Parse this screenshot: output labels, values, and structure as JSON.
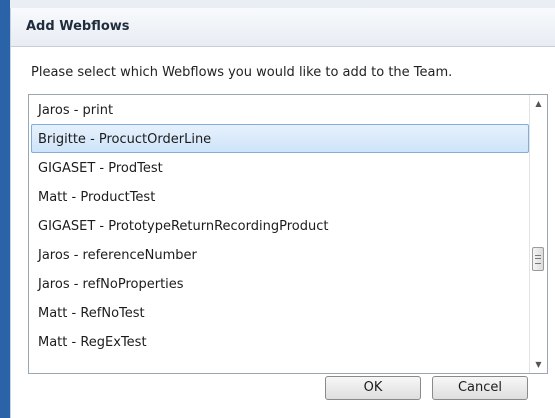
{
  "dialog": {
    "title": "Add Webflows",
    "prompt": "Please select which Webflows you would like to add to the Team."
  },
  "list": {
    "items": [
      {
        "label": "Jaros - print",
        "selected": false
      },
      {
        "label": "Brigitte - ProcuctOrderLine",
        "selected": true
      },
      {
        "label": "GIGASET - ProdTest",
        "selected": false
      },
      {
        "label": "Matt - ProductTest",
        "selected": false
      },
      {
        "label": "GIGASET - PrototypeReturnRecordingProduct",
        "selected": false
      },
      {
        "label": "Jaros - referenceNumber",
        "selected": false
      },
      {
        "label": "Jaros - refNoProperties",
        "selected": false
      },
      {
        "label": "Matt - RefNoTest",
        "selected": false
      },
      {
        "label": "Matt - RegExTest",
        "selected": false
      }
    ],
    "scroll_up_icon": "triangle-up",
    "scroll_down_icon": "triangle-down"
  },
  "buttons": {
    "ok_label": "OK",
    "cancel_label": "Cancel"
  },
  "colors": {
    "accent_bar": "#2a63a7",
    "selection_bg": "#cfe4fa",
    "selection_border": "#84acdd"
  }
}
